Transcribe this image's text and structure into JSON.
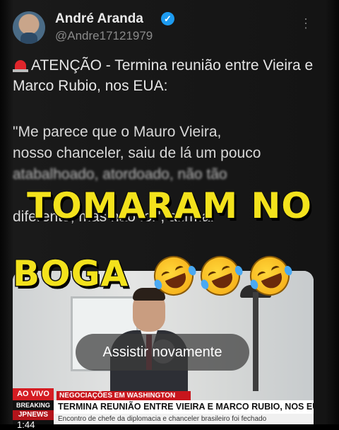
{
  "tweet": {
    "author_name": "André Aranda",
    "author_handle": "@Andre17121979",
    "more_label": "⋮",
    "verified_label": "✓",
    "alert_text": "ATENÇÃO - Termina reunião entre Vieira e Marco Rubio, nos EUA:",
    "quote_lines": [
      "\"Me parece que o Mauro Vieira,",
      "nosso chanceler, saiu de lá um pouco",
      "atabalhoado, atordoado, não tão",
      "diferente, mas não foi\", afirma."
    ],
    "alert_icon": "police-siren-icon"
  },
  "video": {
    "replay_label": "Assistir novamente",
    "ticker": {
      "live_label": "AO VIVO",
      "breaking_label": "BREAKING",
      "channel_label": "JPNEWS",
      "time": "1:44",
      "section": "NEGOCIAÇÕES EM WASHINGTON",
      "headline": "TERMINA REUNIÃO ENTRE VIEIRA E MARCO RUBIO, NOS EUA",
      "subline": "Encontro de chefe da diplomacia e chanceler brasileiro foi fechado"
    }
  },
  "overlay": {
    "caption_line1": "TOMARAM NO",
    "caption_line2": "BOGA",
    "emoji_icon": "rolling-on-floor-laughing-icon",
    "caption_color": "#f3e21c"
  },
  "colors": {
    "background": "#141414",
    "verified": "#1d9bf0",
    "live_red": "#d51c22"
  }
}
